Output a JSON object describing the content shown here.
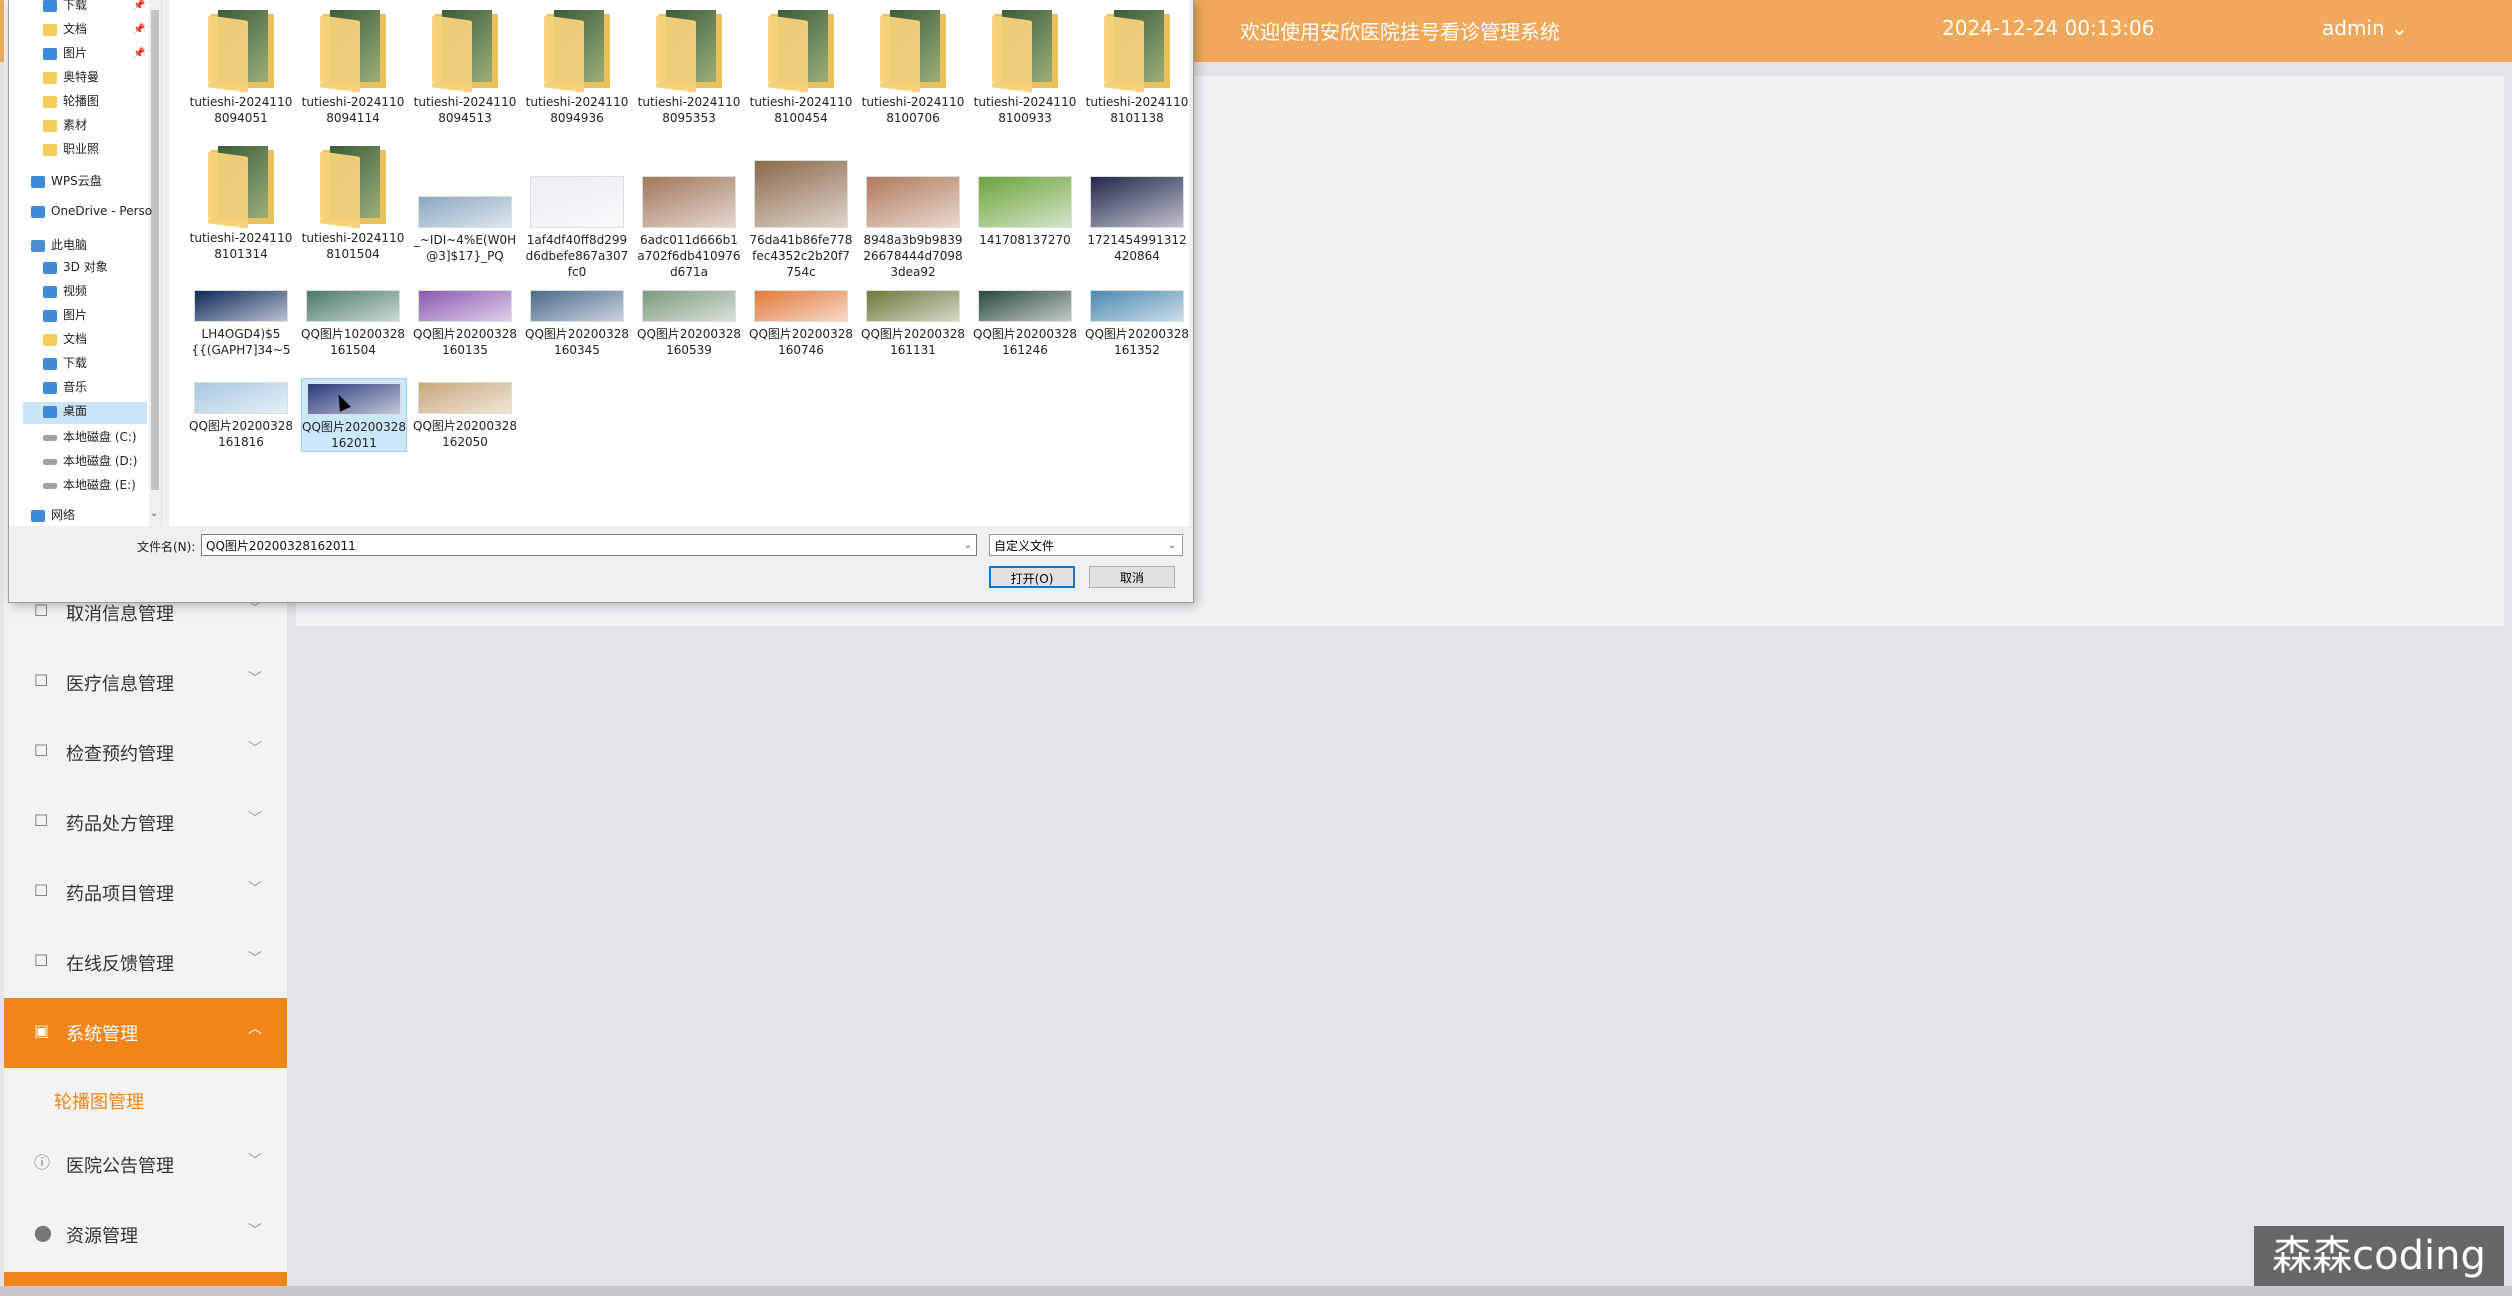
{
  "app": {
    "welcome": "欢迎使用安欣医院挂号看诊管理系统",
    "datetime": "2024-12-24 00:13:06",
    "user": "admin",
    "user_chevron": "⌄"
  },
  "sidebar": {
    "items": [
      {
        "label": "取消信息管理",
        "icon": "document-icon"
      },
      {
        "label": "医疗信息管理",
        "icon": "document-icon"
      },
      {
        "label": "检查预约管理",
        "icon": "document-icon"
      },
      {
        "label": "药品处方管理",
        "icon": "document-icon"
      },
      {
        "label": "药品项目管理",
        "icon": "document-icon"
      },
      {
        "label": "在线反馈管理",
        "icon": "document-icon"
      },
      {
        "label": "系统管理",
        "icon": "image-icon",
        "active": true
      },
      {
        "label": "医院公告管理",
        "icon": "info-icon"
      },
      {
        "label": "资源管理",
        "icon": "location-icon"
      }
    ],
    "submenu_label": "轮播图管理"
  },
  "dialog": {
    "nav": [
      {
        "label": "下载",
        "icon": "download-icon",
        "pinned": true
      },
      {
        "label": "文档",
        "icon": "document-icon",
        "pinned": true
      },
      {
        "label": "图片",
        "icon": "picture-icon",
        "pinned": true
      },
      {
        "label": "奥特曼",
        "icon": "folder-icon"
      },
      {
        "label": "轮播图",
        "icon": "folder-icon"
      },
      {
        "label": "素材",
        "icon": "folder-icon"
      },
      {
        "label": "职业照",
        "icon": "folder-icon"
      },
      {
        "label": "WPS云盘",
        "icon": "cloud-icon"
      },
      {
        "label": "OneDrive - Perso",
        "icon": "cloud-icon"
      },
      {
        "label": "此电脑",
        "icon": "pc-icon"
      },
      {
        "label": "3D 对象",
        "icon": "cube-icon"
      },
      {
        "label": "视频",
        "icon": "video-icon"
      },
      {
        "label": "图片",
        "icon": "picture-icon"
      },
      {
        "label": "文档",
        "icon": "document-icon"
      },
      {
        "label": "下载",
        "icon": "download-icon"
      },
      {
        "label": "音乐",
        "icon": "music-icon"
      },
      {
        "label": "桌面",
        "icon": "desktop-icon",
        "selected": true
      },
      {
        "label": "本地磁盘 (C:)",
        "icon": "drive-icon"
      },
      {
        "label": "本地磁盘 (D:)",
        "icon": "drive-icon"
      },
      {
        "label": "本地磁盘 (E:)",
        "icon": "drive-icon"
      },
      {
        "label": "网络",
        "icon": "network-icon"
      }
    ],
    "files": [
      {
        "name": "tutieshi-20241108094051",
        "type": "folder"
      },
      {
        "name": "tutieshi-20241108094114",
        "type": "folder"
      },
      {
        "name": "tutieshi-20241108094513",
        "type": "folder"
      },
      {
        "name": "tutieshi-20241108094936",
        "type": "folder"
      },
      {
        "name": "tutieshi-20241108095353",
        "type": "folder"
      },
      {
        "name": "tutieshi-20241108100454",
        "type": "folder"
      },
      {
        "name": "tutieshi-20241108100706",
        "type": "folder"
      },
      {
        "name": "tutieshi-20241108100933",
        "type": "folder"
      },
      {
        "name": "tutieshi-20241108101138",
        "type": "folder"
      },
      {
        "name": "tutieshi-20241108101314",
        "type": "folder"
      },
      {
        "name": "tutieshi-20241108101504",
        "type": "folder"
      },
      {
        "name": "_~IDI~4%E(W0H@3]$17}_PQ",
        "type": "image",
        "color": "#8aa8c0"
      },
      {
        "name": "1af4df40ff8d299d6dbefe867a307fc0",
        "type": "image",
        "color": "#e8eef2"
      },
      {
        "name": "6adc011d666b1a702f6db410976d671a",
        "type": "image",
        "color": "#a0775a"
      },
      {
        "name": "76da41b86fe778fec4352c2b20f7754c",
        "type": "image",
        "color": "#8a6a4a"
      },
      {
        "name": "8948a3b9b983926678444d70983dea92",
        "type": "image",
        "color": "#b07a5a"
      },
      {
        "name": "141708137270",
        "type": "image",
        "color": "#6aa43a"
      },
      {
        "name": "1721454991312420864",
        "type": "image",
        "color": "#20294a"
      },
      {
        "name": "LH4OGD4)$5{{(GAPH7]34~5",
        "type": "image",
        "color": "#0f2a5a"
      },
      {
        "name": "QQ图片10200328161504",
        "type": "image",
        "color": "#4a7a6a"
      },
      {
        "name": "QQ图片20200328160135",
        "type": "image",
        "color": "#8a5ab0"
      },
      {
        "name": "QQ图片20200328160345",
        "type": "image",
        "color": "#4a6a8a"
      },
      {
        "name": "QQ图片20200328160539",
        "type": "image",
        "color": "#7a9a7a"
      },
      {
        "name": "QQ图片20200328160746",
        "type": "image",
        "color": "#e07a3a"
      },
      {
        "name": "QQ图片20200328161131",
        "type": "image",
        "color": "#6a7a3a"
      },
      {
        "name": "QQ图片20200328161246",
        "type": "image",
        "color": "#2a4a3a"
      },
      {
        "name": "QQ图片20200328161352",
        "type": "image",
        "color": "#4a8ab0"
      },
      {
        "name": "QQ图片20200328161816",
        "type": "image",
        "color": "#a8c8e0"
      },
      {
        "name": "QQ图片20200328162011",
        "type": "image",
        "color": "#2a3a7a",
        "selected": true
      },
      {
        "name": "QQ图片20200328162050",
        "type": "image",
        "color": "#c8a87a"
      }
    ],
    "filename_label": "文件名(N):",
    "filename_value": "QQ图片20200328162011",
    "filetype_value": "自定义文件",
    "open_label": "打开(O)",
    "cancel_label": "取消"
  },
  "watermark": "森森coding"
}
